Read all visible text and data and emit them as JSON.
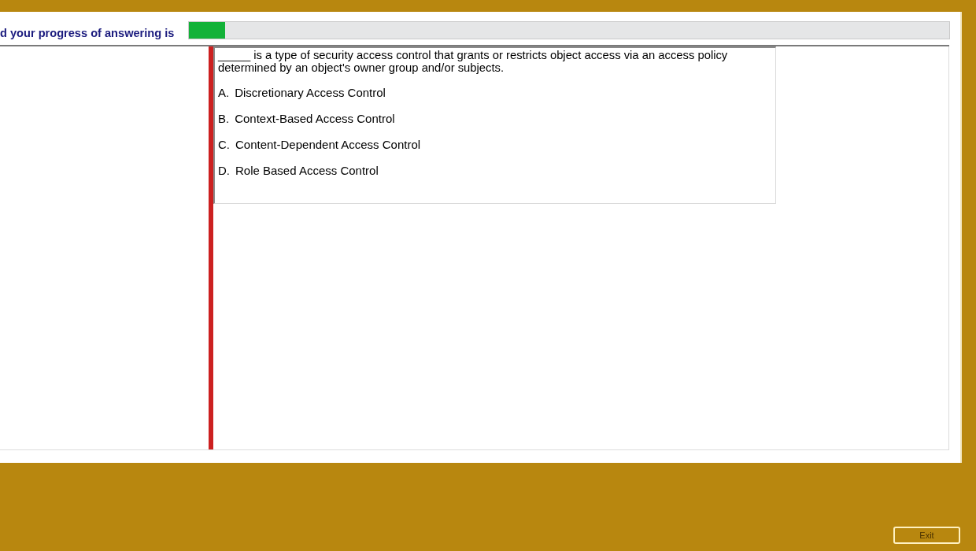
{
  "progress": {
    "label": "d your progress of answering is",
    "level": 0.048
  },
  "question": {
    "text": "_____ is a type of security access control that grants or restricts object access via an access policy determined by an object's owner group and/or subjects.",
    "options": [
      {
        "letter": "A.",
        "text": "Discretionary Access Control"
      },
      {
        "letter": "B.",
        "text": "Context-Based Access Control"
      },
      {
        "letter": "C.",
        "text": "Content-Dependent Access Control"
      },
      {
        "letter": "D.",
        "text": "Role Based Access Control"
      }
    ]
  },
  "exit_button": {
    "label": "Exit"
  }
}
